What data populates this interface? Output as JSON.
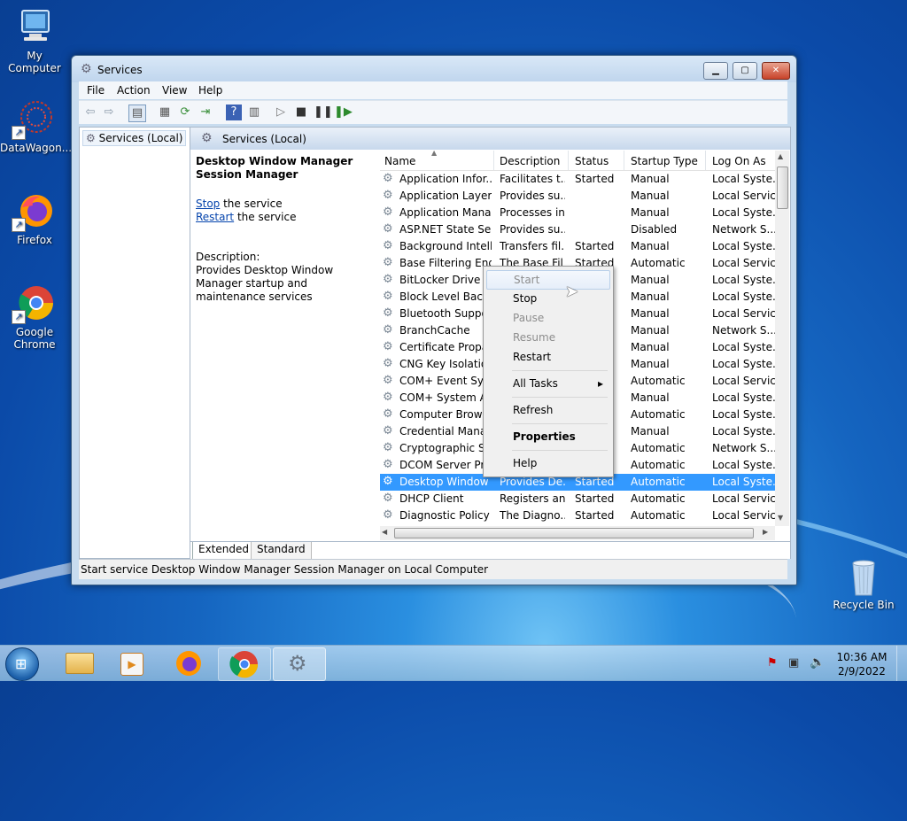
{
  "desktop": {
    "icons": [
      {
        "name": "my-computer",
        "label": "My Computer"
      },
      {
        "name": "datawagon",
        "label": "DataWagon..."
      },
      {
        "name": "firefox",
        "label": "Firefox"
      },
      {
        "name": "google-chrome",
        "label": "Google Chrome"
      },
      {
        "name": "recycle-bin",
        "label": "Recycle Bin"
      }
    ]
  },
  "window": {
    "title": "Services",
    "menu": [
      "File",
      "Action",
      "View",
      "Help"
    ],
    "tree_root": "Services (Local)",
    "pane_title": "Services (Local)",
    "selected_service": {
      "title": "Desktop Window Manager Session Manager",
      "stop_link": "Stop",
      "stop_suffix": " the service",
      "restart_link": "Restart",
      "restart_suffix": " the service",
      "description_label": "Description:",
      "description": "Provides Desktop Window Manager startup and maintenance services"
    },
    "columns": [
      "Name",
      "Description",
      "Status",
      "Startup Type",
      "Log On As"
    ],
    "rows": [
      [
        "Application Infor...",
        "Facilitates t...",
        "Started",
        "Manual",
        "Local Syste..."
      ],
      [
        "Application Layer ...",
        "Provides su...",
        "",
        "Manual",
        "Local Service"
      ],
      [
        "Application Mana...",
        "Processes in...",
        "",
        "Manual",
        "Local Syste..."
      ],
      [
        "ASP.NET State Ser...",
        "Provides su...",
        "",
        "Disabled",
        "Network S..."
      ],
      [
        "Background Intelli...",
        "Transfers fil...",
        "Started",
        "Manual",
        "Local Syste..."
      ],
      [
        "Base Filtering Engi",
        "The Base Fil",
        "Started",
        "Automatic",
        "Local Service"
      ],
      [
        "BitLocker Drive En",
        "",
        "",
        "Manual",
        "Local Syste..."
      ],
      [
        "Block Level Backu",
        "",
        "",
        "Manual",
        "Local Syste..."
      ],
      [
        "Bluetooth Support",
        "",
        "",
        "Manual",
        "Local Service"
      ],
      [
        "BranchCache",
        "",
        "",
        "Manual",
        "Network S..."
      ],
      [
        "Certificate Propag",
        "",
        "",
        "Manual",
        "Local Syste..."
      ],
      [
        "CNG Key Isolation",
        "",
        "",
        "Manual",
        "Local Syste..."
      ],
      [
        "COM+ Event Syst...",
        "",
        "",
        "Automatic",
        "Local Service"
      ],
      [
        "COM+ System Ap",
        "",
        "",
        "Manual",
        "Local Syste..."
      ],
      [
        "Computer Browse",
        "",
        "",
        "Automatic",
        "Local Syste..."
      ],
      [
        "Credential Manag",
        "",
        "",
        "Manual",
        "Local Syste..."
      ],
      [
        "Cryptographic Ser",
        "",
        "",
        "Automatic",
        "Network S..."
      ],
      [
        "DCOM Server Pro...",
        "",
        "",
        "Automatic",
        "Local Syste..."
      ],
      [
        "Desktop Window ...",
        "Provides De...",
        "Started",
        "Automatic",
        "Local Syste..."
      ],
      [
        "DHCP Client",
        "Registers an...",
        "Started",
        "Automatic",
        "Local Service"
      ],
      [
        "Diagnostic Policy ...",
        "The Diagno...",
        "Started",
        "Automatic",
        "Local Service"
      ]
    ],
    "selected_row_index": 18,
    "tabs": [
      "Extended",
      "Standard"
    ],
    "status": "Start service Desktop Window Manager Session Manager on Local Computer"
  },
  "context_menu": {
    "items": [
      {
        "label": "Start",
        "enabled": false
      },
      {
        "label": "Stop",
        "enabled": true
      },
      {
        "label": "Pause",
        "enabled": false
      },
      {
        "label": "Resume",
        "enabled": false
      },
      {
        "label": "Restart",
        "enabled": true
      },
      {
        "label": "All Tasks",
        "enabled": true,
        "submenu": true
      },
      {
        "label": "Refresh",
        "enabled": true
      },
      {
        "label": "Properties",
        "enabled": true,
        "bold": true
      },
      {
        "label": "Help",
        "enabled": true
      }
    ]
  },
  "taskbar": {
    "clock_time": "10:36 AM",
    "clock_date": "2/9/2022"
  },
  "colors": {
    "selection": "#3399ff",
    "desktop_blue": "#1565c0"
  }
}
